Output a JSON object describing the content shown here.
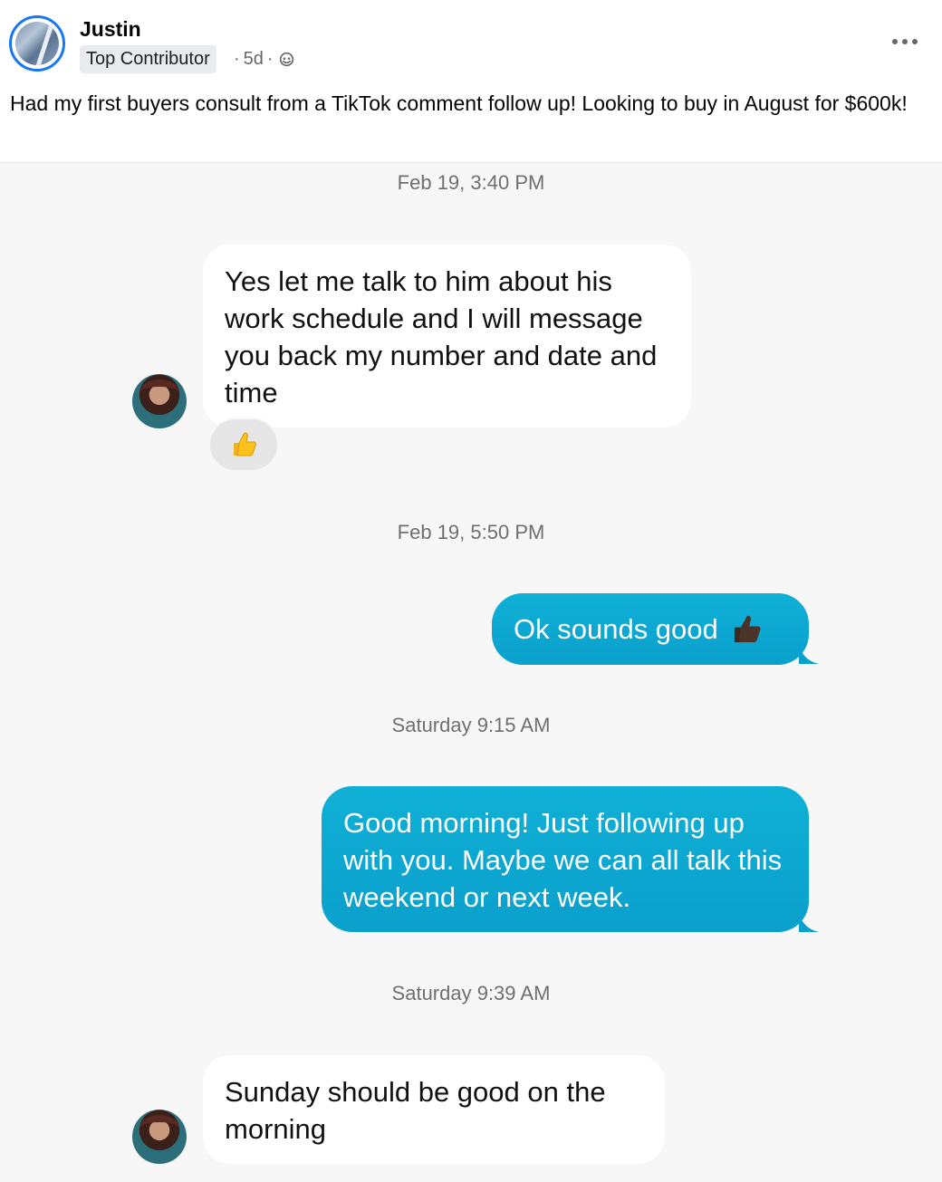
{
  "post": {
    "author": "Justin",
    "badge": "Top Contributor",
    "age": "5d",
    "separator": "·",
    "text": "Had my first buyers consult from a TikTok comment follow up!  Looking to buy in August for $600k!",
    "more_icon": "more-horizontal-icon",
    "privacy_icon": "globe-icon"
  },
  "conversation": {
    "timestamps": [
      "Feb 19, 3:40 PM",
      "Feb 19, 5:50 PM",
      "Saturday 9:15 AM",
      "Saturday 9:39 AM"
    ],
    "messages": [
      {
        "direction": "incoming",
        "text": "Yes let me talk to him about his work schedule and I will message you back my number and date and time",
        "reaction": "thumbs-up-icon"
      },
      {
        "direction": "outgoing",
        "text": "Ok sounds good",
        "emoji": "thumbs-up-dark-icon"
      },
      {
        "direction": "outgoing",
        "text": "Good morning!  Just following up with you.  Maybe we can all talk this weekend or next week."
      },
      {
        "direction": "incoming",
        "text": "Sunday should be good on the morning"
      }
    ],
    "colors": {
      "outgoing_bubble": "#0aa8d4",
      "incoming_bubble": "#ffffff",
      "background": "#f7f7f7"
    }
  }
}
